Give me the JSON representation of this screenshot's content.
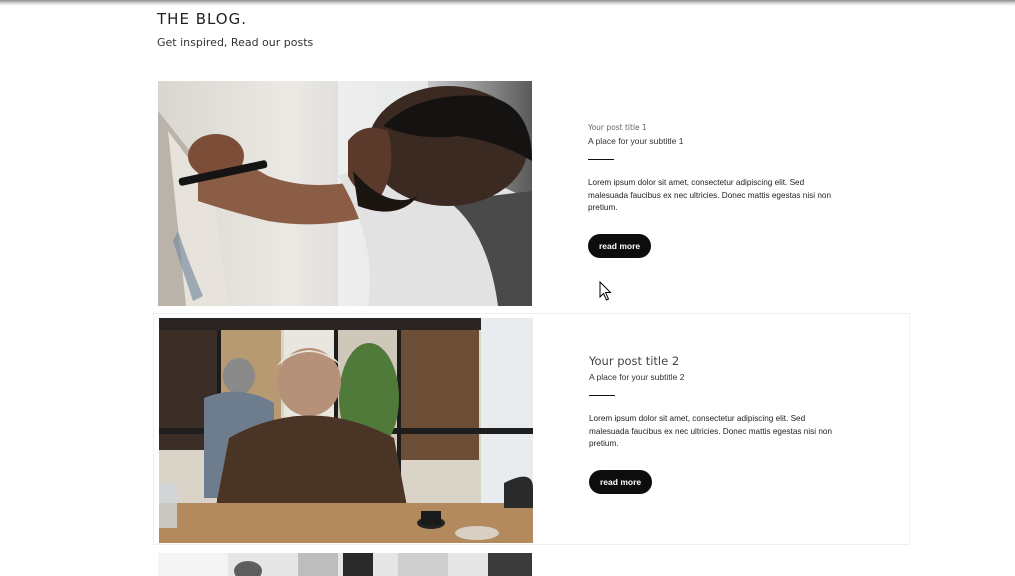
{
  "header": {
    "title": "THE BLOG.",
    "subtitle": "Get inspired, Read our posts"
  },
  "posts": [
    {
      "title": "Your post title 1",
      "subtitle": "A place for your subtitle 1",
      "body": "Lorem ipsum dolor sit amet, consectetur adipiscing elit. Sed malesuada faucibus ex nec ultricies. Donec mattis egestas nisi non pretium.",
      "button_label": "read more",
      "image": "man-painting-on-canvas"
    },
    {
      "title": "Your post title 2",
      "subtitle": "A place for your subtitle 2",
      "body": "Lorem ipsum dolor sit amet, consectetur adipiscing elit. Sed malesuada faucibus ex nec ultricies. Donec mattis egestas nisi non pretium.",
      "button_label": "read more",
      "image": "elderly-man-in-cafe"
    },
    {
      "image": "cafe-scene-partial"
    }
  ],
  "colors": {
    "button_bg": "#0d0d0d",
    "button_text": "#ffffff",
    "text": "#222222"
  },
  "cursor": "arrow-cursor-icon"
}
